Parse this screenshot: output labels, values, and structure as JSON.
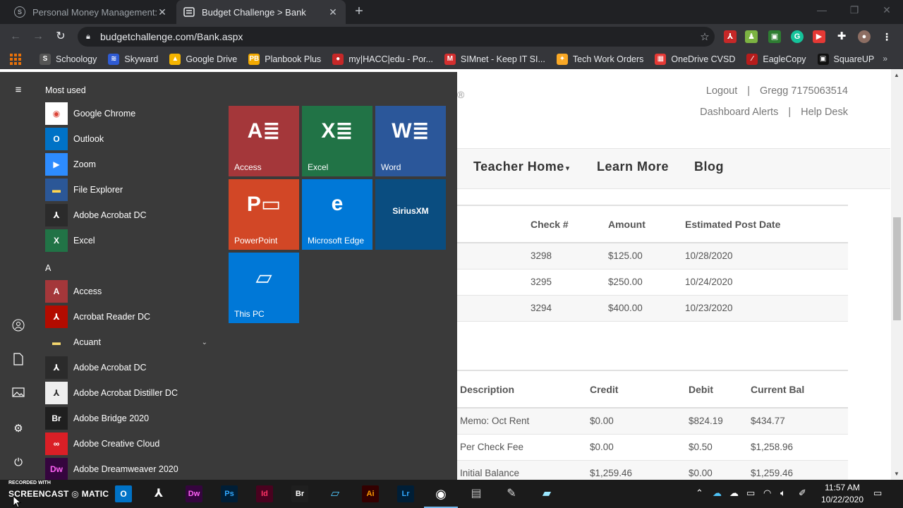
{
  "browser": {
    "tabs": [
      {
        "title": "Personal Money Management: R",
        "favicon": "S"
      },
      {
        "title": "Budget Challenge > Bank",
        "favicon": "page"
      }
    ],
    "url": "budgetchallenge.com/Bank.aspx",
    "bookmarks": [
      {
        "label": "Schoology",
        "icon": "S",
        "color": "#555555"
      },
      {
        "label": "Skyward",
        "icon": "≋",
        "color": "#2f5bd3"
      },
      {
        "label": "Google Drive",
        "icon": "▲",
        "color": "#f4b400"
      },
      {
        "label": "Planbook Plus",
        "icon": "PB",
        "color": "#f2a900"
      },
      {
        "label": "my|HACC|edu - Por...",
        "icon": "●",
        "color": "#c62828"
      },
      {
        "label": "SIMnet - Keep IT SI...",
        "icon": "M",
        "color": "#d32f2f"
      },
      {
        "label": "Tech Work Orders",
        "icon": "✦",
        "color": "#f9a825"
      },
      {
        "label": "OneDrive CVSD",
        "icon": "▦",
        "color": "#e53935"
      },
      {
        "label": "EagleCopy",
        "icon": "∕",
        "color": "#b71c1c"
      },
      {
        "label": "SquareUP",
        "icon": "▣",
        "color": "#111111"
      }
    ],
    "bookmarks_more": "»"
  },
  "site": {
    "reg_mark": "®",
    "toplinks": {
      "logout": "Logout",
      "sep": "|",
      "user": "Gregg 7175063514",
      "alerts": "Dashboard Alerts",
      "help": "Help Desk"
    },
    "nav": {
      "teacher_home": "Teacher Home",
      "caret": "▾",
      "learn_more": "Learn More",
      "blog": "Blog"
    },
    "checks_table": {
      "headers": [
        "Check #",
        "Amount",
        "Estimated Post Date"
      ],
      "rows": [
        [
          "3298",
          "$125.00",
          "10/28/2020"
        ],
        [
          "3295",
          "$250.00",
          "10/24/2020"
        ],
        [
          "3294",
          "$400.00",
          "10/23/2020"
        ]
      ]
    },
    "transactions_table": {
      "headers": [
        "Description",
        "Credit",
        "Debit",
        "Current Bal"
      ],
      "rows": [
        [
          "Memo: Oct Rent",
          "$0.00",
          "$824.19",
          "$434.77"
        ],
        [
          "Per Check Fee",
          "$0.00",
          "$0.50",
          "$1,258.96"
        ],
        [
          "Initial Balance",
          "$1,259.46",
          "$0.00",
          "$1,259.46"
        ]
      ]
    }
  },
  "start_menu": {
    "most_used_heading": "Most used",
    "most_used": [
      {
        "label": "Google Chrome",
        "icon": "chrome-icon",
        "bg": "#ffffff",
        "glyph": "◉",
        "fg": "#db4437"
      },
      {
        "label": "Outlook",
        "icon": "outlook-icon",
        "bg": "#0072c6",
        "glyph": "O",
        "fg": "#ffffff"
      },
      {
        "label": "Zoom",
        "icon": "zoom-icon",
        "bg": "#2d8cff",
        "glyph": "▶",
        "fg": "#ffffff"
      },
      {
        "label": "File Explorer",
        "icon": "folder-icon",
        "bg": "#2b5797",
        "glyph": "▬",
        "fg": "#ffd54f"
      },
      {
        "label": "Adobe Acrobat DC",
        "icon": "acrobat-icon",
        "bg": "#2b2b2b",
        "glyph": "⅄",
        "fg": "#ffffff"
      },
      {
        "label": "Excel",
        "icon": "excel-icon",
        "bg": "#217346",
        "glyph": "X",
        "fg": "#ffffff"
      }
    ],
    "letter_heading": "A",
    "all_apps": [
      {
        "label": "Access",
        "icon": "access-icon",
        "bg": "#a4373a",
        "glyph": "A",
        "fg": "#ffffff"
      },
      {
        "label": "Acrobat Reader DC",
        "icon": "acrobat-reader-icon",
        "bg": "#b30b00",
        "glyph": "⅄",
        "fg": "#ffffff"
      },
      {
        "label": "Acuant",
        "icon": "folder-icon",
        "bg": "#3a3a3a",
        "glyph": "▬",
        "fg": "#f5d76e",
        "expand": "⌄"
      },
      {
        "label": "Adobe Acrobat DC",
        "icon": "acrobat-icon",
        "bg": "#2b2b2b",
        "glyph": "⅄",
        "fg": "#ffffff"
      },
      {
        "label": "Adobe Acrobat Distiller DC",
        "icon": "distiller-icon",
        "bg": "#eeeeee",
        "glyph": "⅄",
        "fg": "#333333"
      },
      {
        "label": "Adobe Bridge 2020",
        "icon": "bridge-icon",
        "bg": "#1f1f1f",
        "glyph": "Br",
        "fg": "#ffffff"
      },
      {
        "label": "Adobe Creative Cloud",
        "icon": "creative-cloud-icon",
        "bg": "#da1f26",
        "glyph": "∞",
        "fg": "#ffffff"
      },
      {
        "label": "Adobe Dreamweaver 2020",
        "icon": "dreamweaver-icon",
        "bg": "#35053e",
        "glyph": "Dw",
        "fg": "#ff61f6"
      }
    ],
    "tiles": [
      {
        "label": "Access",
        "bg": "#a4373a",
        "glyph": "A≣"
      },
      {
        "label": "Excel",
        "bg": "#217346",
        "glyph": "X≣"
      },
      {
        "label": "Word",
        "bg": "#2b579a",
        "glyph": "W≣"
      },
      {
        "label": "PowerPoint",
        "bg": "#d24726",
        "glyph": "P▭"
      },
      {
        "label": "Microsoft Edge",
        "bg": "#0078d7",
        "glyph": "e"
      },
      {
        "label": "",
        "bg": "#0a4d80",
        "glyph": "SiriusXM"
      },
      {
        "label": "This PC",
        "bg": "#0078d7",
        "glyph": "▱"
      }
    ]
  },
  "taskbar": {
    "watermark_small": "RECORDED WITH",
    "watermark_big": "SCREENCAST ◎ MATIC",
    "time": "11:57 AM",
    "date": "10/22/2020"
  }
}
